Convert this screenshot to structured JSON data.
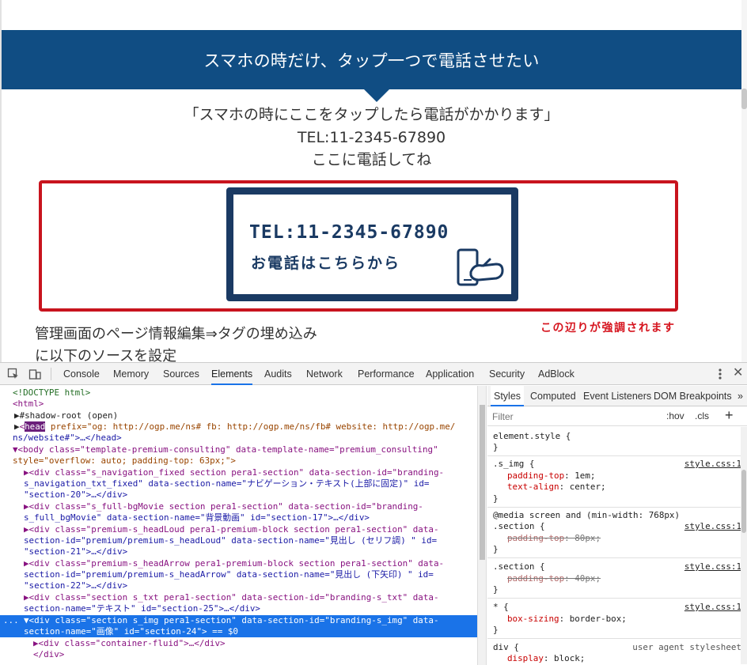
{
  "page": {
    "heading": "スマホの時だけ、タップ一つで電話させたい",
    "line1": "「スマホの時にここをタップしたら電話がかかります」",
    "line2": "TEL:11-2345-67890",
    "line3": "ここに電話してね",
    "banner_tel": "TEL:11-2345-67890",
    "banner_cta": "お電話はこちらから",
    "emphasis_note": "この辺りが強調されます",
    "body1": "管理画面のページ情報編集⇒タグの埋め込み",
    "body2": "に以下のソースを設定",
    "colors": {
      "band": "#104d83",
      "highlight": "#c8141e",
      "note": "#d6141e"
    }
  },
  "devtools": {
    "tabs": [
      "Console",
      "Memory",
      "Sources",
      "Elements",
      "Audits",
      "Network",
      "Performance",
      "Application",
      "Security",
      "AdBlock"
    ],
    "active_tab": "Elements",
    "dom": {
      "l0": "<!DOCTYPE html>",
      "l1": "<html>",
      "l2": "#shadow-root (open)",
      "l3_tag": "head",
      "l3a": " prefix=\"og: http://ogp.me/ns# fb: http://ogp.me/ns/fb# website: http://ogp.me/",
      "l3b": "ns/website#\">…</head>",
      "l4a": "▼<body class=\"template-premium-consulting\" data-template-name=\"premium_consulting\"",
      "l4b": "style=\"overflow: auto; padding-top: 63px;\">",
      "l5a": "▶<div class=\"s_navigation_fixed section pera1-section\" data-section-id=\"branding-",
      "l5b": "s_navigation_txt_fixed\" data-section-name=\"ナビゲーション・テキスト(上部に固定)\" id=",
      "l5c": "\"section-20\">…</div>",
      "l6a": "▶<div class=\"s_full-bgMovie section pera1-section\" data-section-id=\"branding-",
      "l6b": "s_full_bgMovie\" data-section-name=\"背景動画\" id=\"section-17\">…</div>",
      "l7a": "▶<div class=\"premium-s_headLoud pera1-premium-block section pera1-section\" data-",
      "l7b": "section-id=\"premium/premium-s_headLoud\" data-section-name=\"見出し (セリフ調) \" id=",
      "l7c": "\"section-21\">…</div>",
      "l8a": "▶<div class=\"premium-s_headArrow pera1-premium-block section pera1-section\" data-",
      "l8b": "section-id=\"premium/premium-s_headArrow\" data-section-name=\"見出し (下矢印) \" id=",
      "l8c": "\"section-22\">…</div>",
      "l9a": "▶<div class=\"section s_txt pera1-section\" data-section-id=\"branding-s_txt\" data-",
      "l9b": "section-name=\"テキスト\" id=\"section-25\">…</div>",
      "l10a": "▼<div class=\"section s_img pera1-section\" data-section-id=\"branding-s_img\" data-",
      "l10b": "section-name=\"画像\" id=\"section-24\"> == $0",
      "l11": "▶<div class=\"container-fluid\">…</div>",
      "l12": "</div>",
      "dots": "..."
    },
    "styles_tabs": [
      "Styles",
      "Computed",
      "Event Listeners",
      "DOM Breakpoints"
    ],
    "styles_more": "»",
    "filter_placeholder": "Filter",
    "hov": ":hov",
    "cls": ".cls",
    "add": "+",
    "rules": {
      "r1a": "element.style {",
      "r1b": "}",
      "r2a": ".s_img {",
      "r2src": "style.css:1",
      "r2p1n": "padding-top",
      "r2p1v": ": 1em;",
      "r2p2n": "text-align",
      "r2p2v": ": center;",
      "r2b": "}",
      "r3m": "@media screen and (min-width: 768px)",
      "r3a": ".section {",
      "r3src": "style.css:1",
      "r3p1n": "padding-top",
      "r3p1v": ": 80px;",
      "r3b": "}",
      "r4a": ".section {",
      "r4src": "style.css:1",
      "r4p1n": "padding-top",
      "r4p1v": ": 40px;",
      "r4b": "}",
      "r5a": "* {",
      "r5src": "style.css:1",
      "r5p1n": "box-sizing",
      "r5p1v": ": border-box;",
      "r5b": "}",
      "r6a": "div {",
      "r6src": "user agent stylesheet",
      "r6p1n": "display",
      "r6p1v": ": block;"
    }
  }
}
